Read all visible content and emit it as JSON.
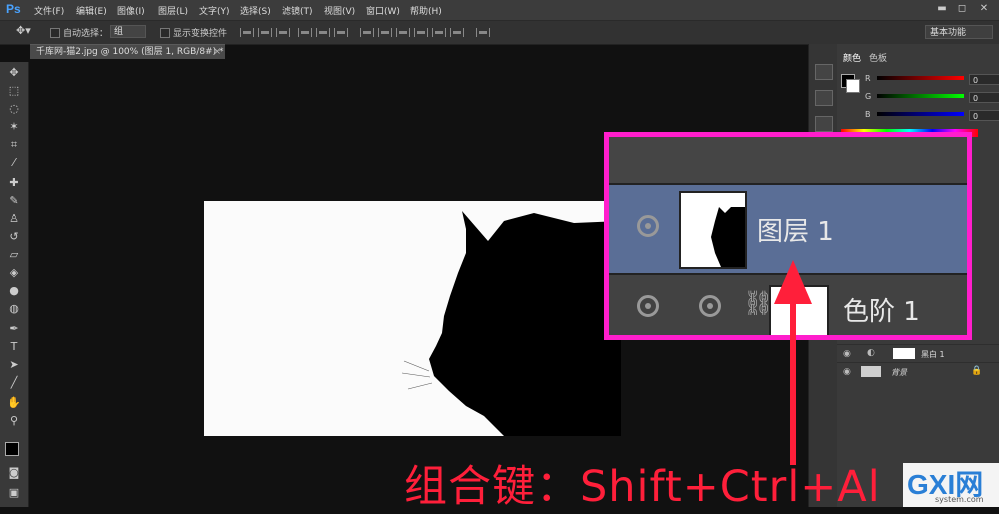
{
  "app": {
    "logo": "Ps"
  },
  "menu": [
    "文件(F)",
    "编辑(E)",
    "图像(I)",
    "图层(L)",
    "文字(Y)",
    "选择(S)",
    "滤镜(T)",
    "视图(V)",
    "窗口(W)",
    "帮助(H)"
  ],
  "window_controls": {
    "minimize": "▬",
    "maximize": "◻",
    "close": "✕"
  },
  "options": {
    "auto_select_label": "自动选择：",
    "auto_select_value": "组",
    "show_transform_label": "显示变换控件",
    "workspace": "基本功能"
  },
  "document": {
    "tab_title": "千库网-猫2.jpg @ 100% (图层 1, RGB/8#) *",
    "tab_close": "×"
  },
  "panels": {
    "color_tab": "颜色",
    "swatches_tab": "色板",
    "channels": [
      {
        "label": "R",
        "value": "0",
        "color": "#e03030"
      },
      {
        "label": "G",
        "value": "0",
        "color": "#30c030"
      },
      {
        "label": "B",
        "value": "0",
        "color": "#3050e0"
      }
    ],
    "layers": [
      {
        "name": "黑白 1"
      },
      {
        "name": "背景"
      }
    ]
  },
  "zoom_callout": {
    "layer_selected": "图层 1",
    "layer_below": "色阶 1"
  },
  "caption": "组合键：Shift+Ctrl+Al",
  "watermark": {
    "brand": "GXI网",
    "url": "system.com"
  },
  "colors": {
    "accent_magenta": "#ff1ecc",
    "caption_red": "#ff1f3a",
    "selected_layer": "#5a6e96"
  }
}
